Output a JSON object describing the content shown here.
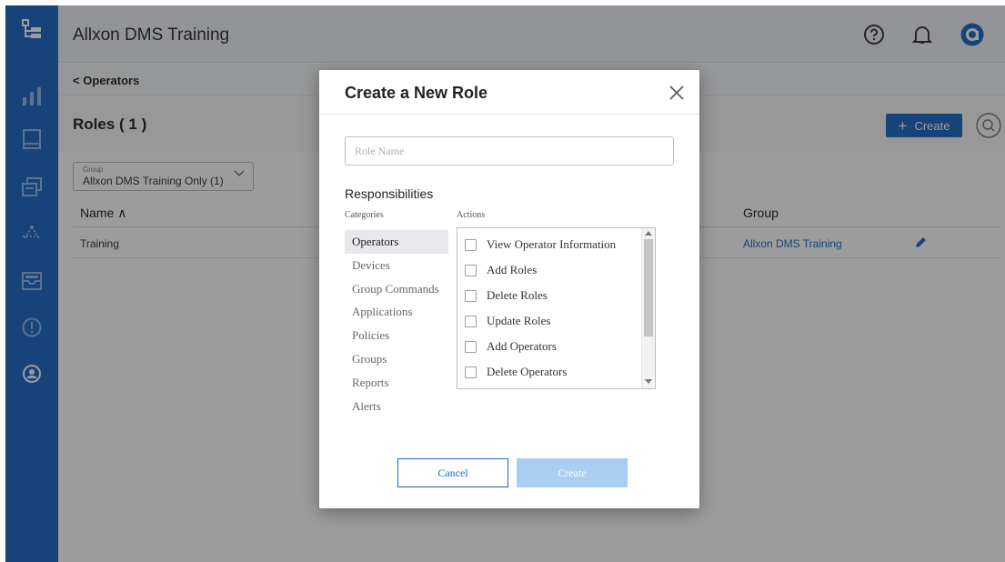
{
  "app": {
    "title": "Allxon DMS Training"
  },
  "sidebar": {
    "items": [
      {
        "icon": "hierarchy-icon"
      },
      {
        "icon": "bar-chart-icon"
      },
      {
        "icon": "device-icon"
      },
      {
        "icon": "group-commands-icon"
      },
      {
        "icon": "network-icon"
      },
      {
        "icon": "inbox-icon"
      },
      {
        "icon": "alert-icon"
      },
      {
        "icon": "operator-icon"
      }
    ]
  },
  "header": {
    "help_icon": "help-icon",
    "bell_icon": "bell-icon",
    "brand_icon": "allxon-logo-icon"
  },
  "breadcrumb": {
    "label": "< Operators"
  },
  "roles": {
    "title": "Roles ( 1 )",
    "create_label": "Create"
  },
  "filter": {
    "label": "Group",
    "value": "Allxon DMS Training Only (1)"
  },
  "table": {
    "columns": {
      "name": "Name ∧",
      "group": "Group"
    },
    "rows": [
      {
        "name": "Training",
        "group": "Allxon DMS Training"
      }
    ]
  },
  "modal": {
    "title": "Create a New Role",
    "role_name_placeholder": "Role Name",
    "responsibilities": "Responsibilities",
    "categories_label": "Categories",
    "actions_label": "Actions",
    "categories": [
      "Operators",
      "Devices",
      "Group Commands",
      "Applications",
      "Policies",
      "Groups",
      "Reports",
      "Alerts"
    ],
    "selected_category": "Operators",
    "actions": [
      "View Operator Information",
      "Add Roles",
      "Delete Roles",
      "Update Roles",
      "Add Operators",
      "Delete Operators"
    ],
    "cancel_label": "Cancel",
    "create_label": "Create"
  },
  "colors": {
    "brand_blue": "#1b67c7",
    "disabled_blue": "#a9cef2",
    "overlay": "rgba(20,20,20,0.42)"
  }
}
